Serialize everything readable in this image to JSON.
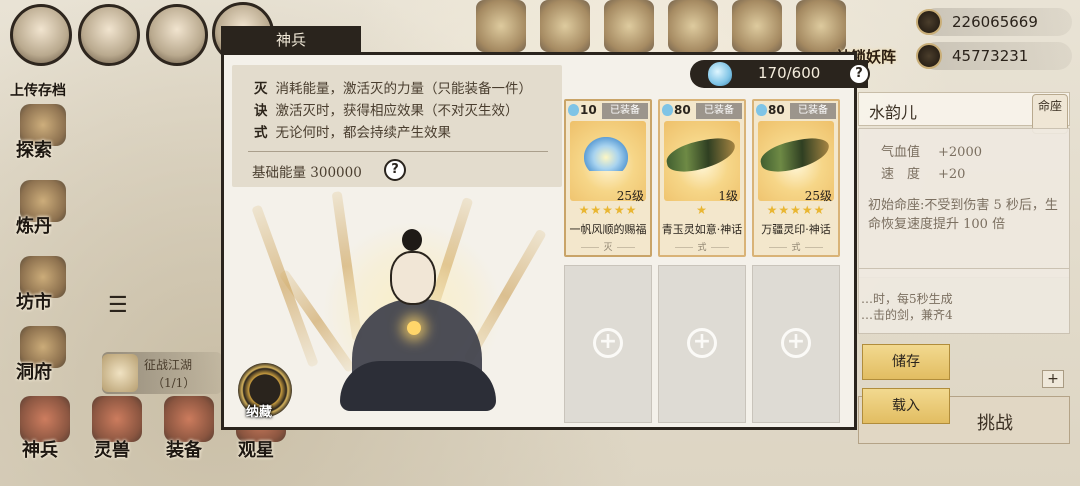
{
  "currency": {
    "gold": "226065669",
    "jade": "45773231"
  },
  "left_menu": {
    "top_label": "上传存档",
    "items": [
      "探索",
      "炼丹",
      "坊市",
      "洞府"
    ]
  },
  "quest": {
    "title": "征战江湖",
    "progress": "（1/1）"
  },
  "bottom_menu": [
    "神兵",
    "灵兽",
    "装备",
    "观星"
  ],
  "popup": {
    "tab_title": "神兵",
    "energy": "170/600",
    "rules": [
      {
        "key": "灭",
        "text": "消耗能量，激活灭的力量（只能装备一件）"
      },
      {
        "key": "诀",
        "text": "激活灭时，获得相应效果（不对灭生效）"
      },
      {
        "key": "式",
        "text": "无论何时，都会持续产生效果"
      }
    ],
    "base_energy": "基础能量 300000",
    "help_symbol": "?",
    "nacang_label": "纳藏",
    "cards": [
      {
        "cost": "10",
        "equipped": "已装备",
        "level": "25级",
        "stars": "★★★★★",
        "name": "一帆风顺的赐福",
        "type": "灭"
      },
      {
        "cost": "80",
        "equipped": "已装备",
        "level": "1级",
        "stars": "★",
        "name": "青玉灵如意·神话",
        "type": "式"
      },
      {
        "cost": "80",
        "equipped": "已装备",
        "level": "25级",
        "stars": "★★★★★",
        "name": "万疆灵印·神话",
        "type": "式"
      }
    ],
    "empty_slot_symbol": "+"
  },
  "right_panel": {
    "name": "水韵儿",
    "badge": "命座",
    "stats": [
      {
        "label": "气血值",
        "value": "+2000"
      },
      {
        "label": "速　度",
        "value": "+20"
      }
    ],
    "desc": "初始命座:不受到伤害 5 秒后，生命恢复速度提升 100 倍",
    "skill_text": "…时，每5秒生成\n…击的剑，兼齐4",
    "plus": "+",
    "challenge": "挑战"
  },
  "side_buttons": {
    "save": "储存",
    "load": "载入"
  },
  "top_banner": "神锁妖阵",
  "colors": {
    "panel_border": "#2a241d",
    "button_gold": "#e2bd62",
    "star": "#e9b632",
    "equipped_tag": "#9c958c"
  }
}
